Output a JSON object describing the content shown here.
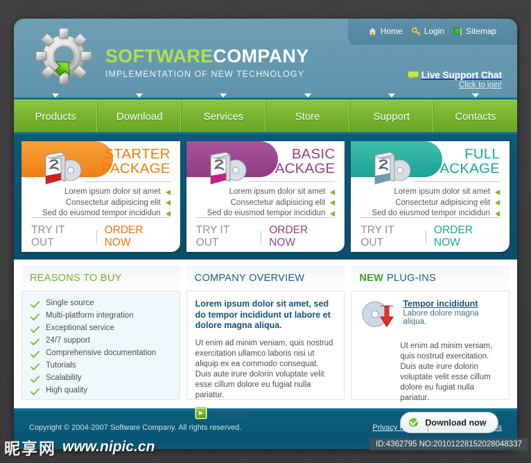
{
  "header": {
    "logo_icon": "gear-with-arrow-icon",
    "brand_primary": "SOFTWARE",
    "brand_secondary": "COMPANY",
    "tagline": "IMPLEMENTATION OF NEW TECHNOLOGY",
    "top_links": [
      {
        "label": "Home",
        "icon": "home-icon"
      },
      {
        "label": "Login",
        "icon": "key-icon"
      },
      {
        "label": "Sitemap",
        "icon": "flag-icon"
      }
    ],
    "live_support": {
      "icon": "chat-bubble-icon",
      "title": "Live Support Chat",
      "subtitle": "Click to join!"
    }
  },
  "nav": {
    "items": [
      {
        "label": "Products"
      },
      {
        "label": "Download"
      },
      {
        "label": "Services"
      },
      {
        "label": "Store"
      },
      {
        "label": "Support"
      },
      {
        "label": "Contacts"
      }
    ]
  },
  "packages": [
    {
      "title_line1": "STARTER",
      "title_line2": "PACKAGE",
      "accent": "#f0700d",
      "icon": "software-box-cd-icon",
      "features": [
        "Lorem ipsum dolor sit amet",
        "Consectetur adipisicing elit",
        "Sed do eiusmod tempor incididun"
      ],
      "try_label": "TRY IT OUT",
      "order_label": "ORDER NOW"
    },
    {
      "title_line1": "BASIC",
      "title_line2": "PACKAGE",
      "accent": "#953f88",
      "icon": "software-box-cd-icon",
      "features": [
        "Lorem ipsum dolor sit amet",
        "Consectetur adipisicing elit",
        "Sed do eiusmod tempor incididun"
      ],
      "try_label": "TRY IT OUT",
      "order_label": "ORDER NOW"
    },
    {
      "title_line1": "FULL",
      "title_line2": "PACKAGE",
      "accent": "#17a79a",
      "icon": "software-box-cd-icon",
      "features": [
        "Lorem ipsum dolor sit amet",
        "Consectetur adipisicing elit",
        "Sed do eiusmod tempor incididun"
      ],
      "try_label": "TRY IT OUT",
      "order_label": "ORDER NOW"
    }
  ],
  "reasons_panel": {
    "title": "REASONS TO BUY",
    "items": [
      "Single source",
      "Multi-platform integration",
      "Exceptional service",
      "24/7 support",
      "Comprehensive documentation",
      "Tutorials",
      "Scalability",
      "High quality"
    ]
  },
  "overview_panel": {
    "title": "COMPANY OVERVIEW",
    "lead": "Lorem ipsum dolor sit amet, sed do  tempor incididunt ut labore et dolore magna aliqua.",
    "body": "Ut enim ad minim veniam, quis nostrud exercitation ullamco laboris nisi ut aliquip ex ea commodo consequat. Duis aute irure dolorin voluptate velit esse cillum dolore eu fugiat nulla pariatur.",
    "read_more": "Read more",
    "read_more_icon": "play-arrow-icon"
  },
  "plugins_panel": {
    "title_new": "NEW",
    "title_rest": "PLUG-INS",
    "icon": "cd-download-icon",
    "item_title": "Tempor incididunt",
    "item_subtitle": "Labore dolore magna aliqua.",
    "item_body": "Ut enim ad minim veniam, quis nostrud exercitation. Duis aute irure dolorin voluptate velit esse cillum dolore eu fugiat nulla pariatur.",
    "download_label": "Download now",
    "download_icon": "green-check-circle-icon"
  },
  "footer": {
    "copyright": "Copyright © 2004-2007 Software Company. All rights reserved.",
    "links": [
      {
        "label": "Privacy Policy"
      },
      {
        "label": "Terms & Conditions "
      }
    ],
    "separator": "|"
  },
  "watermark": {
    "cn_text": "昵享网",
    "url_text": "www.nipic.cn",
    "id_text": "ID:4362795 NO:20101228152028048337"
  }
}
